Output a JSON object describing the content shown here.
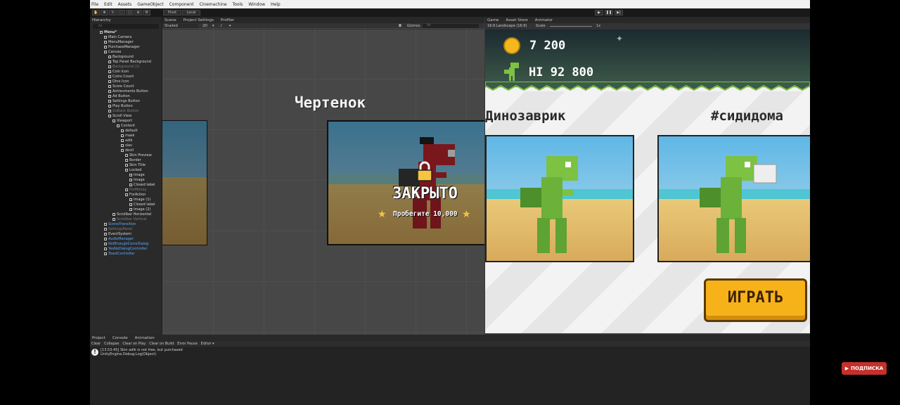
{
  "menu": [
    "File",
    "Edit",
    "Assets",
    "GameObject",
    "Component",
    "Cinemachine",
    "Tools",
    "Window",
    "Help"
  ],
  "toolbar": {
    "pivot": "Pivot",
    "local": "Local"
  },
  "hierarchy": {
    "tab": "Hierarchy",
    "search_placeholder": "All",
    "items": [
      {
        "label": "Menu*",
        "depth": 0,
        "style": "bold"
      },
      {
        "label": "Main Camera",
        "depth": 1
      },
      {
        "label": "MenuManager",
        "depth": 1
      },
      {
        "label": "PurchaseManager",
        "depth": 1
      },
      {
        "label": "Canvas",
        "depth": 1
      },
      {
        "label": "Background",
        "depth": 2
      },
      {
        "label": "Top Panel Background",
        "depth": 2
      },
      {
        "label": "Background (1)",
        "depth": 2,
        "style": "dim"
      },
      {
        "label": "Coin Icon",
        "depth": 2
      },
      {
        "label": "Coins Count",
        "depth": 2
      },
      {
        "label": "Dino Icon",
        "depth": 2
      },
      {
        "label": "Score Count",
        "depth": 2
      },
      {
        "label": "Achievments Button",
        "depth": 2
      },
      {
        "label": "Ad Button",
        "depth": 2
      },
      {
        "label": "Settings Button",
        "depth": 2
      },
      {
        "label": "Play Button",
        "depth": 2
      },
      {
        "label": "GoBack Button",
        "depth": 2,
        "style": "dim"
      },
      {
        "label": "Scroll View",
        "depth": 2
      },
      {
        "label": "Viewport",
        "depth": 3
      },
      {
        "label": "Content",
        "depth": 4
      },
      {
        "label": "default",
        "depth": 5
      },
      {
        "label": "mask",
        "depth": 5
      },
      {
        "label": "adik",
        "depth": 5
      },
      {
        "label": "slav",
        "depth": 5
      },
      {
        "label": "devil",
        "depth": 5
      },
      {
        "label": "Skin Preview",
        "depth": 6
      },
      {
        "label": "Border",
        "depth": 6
      },
      {
        "label": "Skin Title",
        "depth": 6
      },
      {
        "label": "Locked",
        "depth": 6
      },
      {
        "label": "Image",
        "depth": 7
      },
      {
        "label": "Image",
        "depth": 7
      },
      {
        "label": "Closed label",
        "depth": 7
      },
      {
        "label": "ForMoney",
        "depth": 6,
        "style": "dim"
      },
      {
        "label": "ForAction",
        "depth": 6
      },
      {
        "label": "Image (1)",
        "depth": 7
      },
      {
        "label": "Closed label",
        "depth": 7
      },
      {
        "label": "Image (2)",
        "depth": 7
      },
      {
        "label": "Scrollbar Horizontal",
        "depth": 3
      },
      {
        "label": "Scrollbar Vertical",
        "depth": 3,
        "style": "dim"
      },
      {
        "label": "SceneTransition",
        "depth": 1,
        "style": "blue"
      },
      {
        "label": "SettingsPanel",
        "depth": 1,
        "style": "dim"
      },
      {
        "label": "EventSystem",
        "depth": 1
      },
      {
        "label": "AudioManager",
        "depth": 1,
        "style": "blue"
      },
      {
        "label": "NotEnoughCoinsDialog",
        "depth": 1,
        "style": "blue"
      },
      {
        "label": "YesNoDialogController",
        "depth": 1,
        "style": "blue"
      },
      {
        "label": "ToastController",
        "depth": 1,
        "style": "blue"
      }
    ]
  },
  "scene": {
    "tabs": [
      "Scene",
      "Project Settings",
      "Profiler"
    ],
    "shading": "Shaded",
    "mode": "2D",
    "gizmos": "Gizmos",
    "search_placeholder": "All",
    "skin_title": "Чертенок",
    "locked_label": "ЗАКРЫТО",
    "unlock_condition": "Пробегите 10,000"
  },
  "game": {
    "tabs": [
      "Game",
      "Asset Store",
      "Animator"
    ],
    "resolution": "16:9 Landscape (16:9)",
    "scale_label": "Scale",
    "scale_value": "1x",
    "coins": "7 200",
    "hiscore": "HI 92 800",
    "skin1": "Динозаврик",
    "skin2": "#сидидома",
    "play_button": "ИГРАТЬ"
  },
  "console": {
    "tabs": [
      "Project",
      "Console",
      "Animation"
    ],
    "buttons": [
      "Clear",
      "Collapse",
      "Clear on Play",
      "Clear on Build",
      "Error Pause",
      "Editor ▾"
    ],
    "log_line1": "[13:53:45] Skin adik is not free, but purchased",
    "log_line2": "UnityEngine.Debug:Log(Object)"
  },
  "subscribe": "ПОДПИСКА",
  "colors": {
    "accent": "#5aa9ff",
    "coin": "#f5b81c",
    "dino": "#7dc242",
    "devil": "#c4262e",
    "play": "#f7b21a"
  }
}
